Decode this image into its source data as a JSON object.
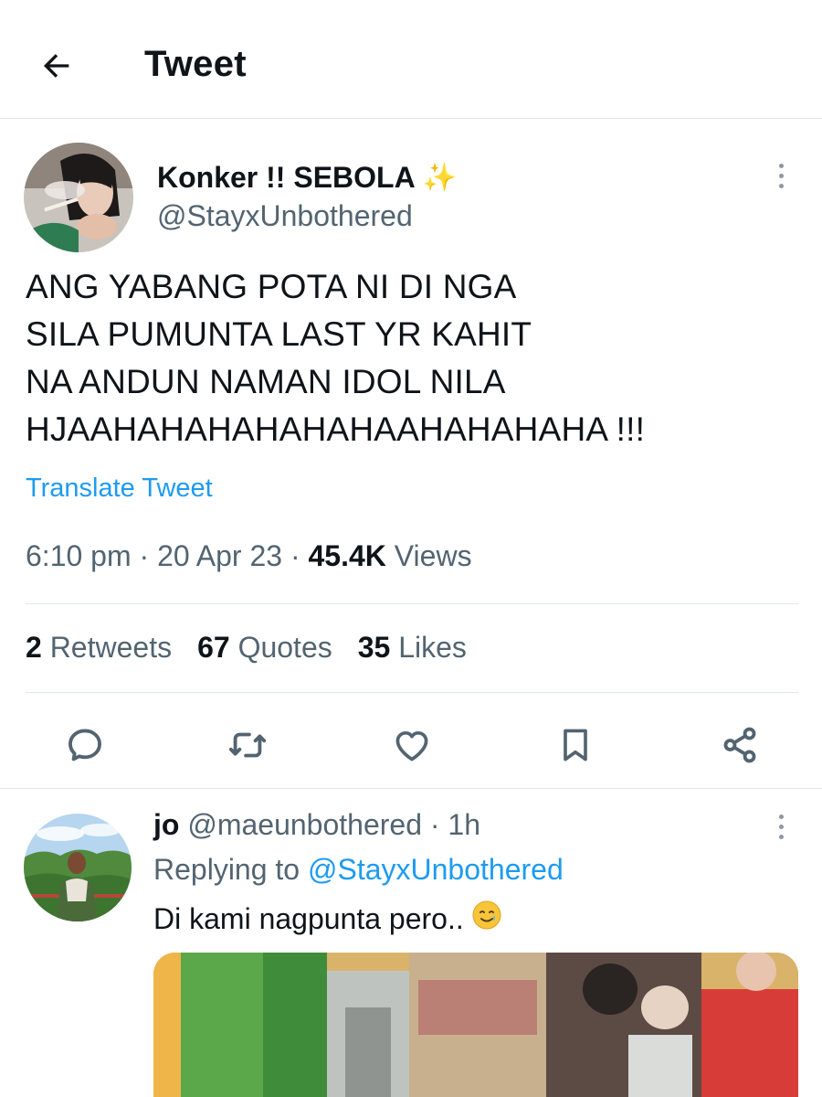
{
  "header": {
    "title": "Tweet"
  },
  "tweet": {
    "display_name": "Konker !! SEBOLA",
    "handle": "@StayxUnbothered",
    "text": "ANG YABANG POTA NI DI NGA\nSILA PUMUNTA LAST YR KAHIT\nNA ANDUN NAMAN IDOL NILA\nHJAAHAHAHAHAHAHAAHAHAHAHA !!!",
    "translate_label": "Translate Tweet",
    "time": "6:10 pm",
    "date": "20 Apr 23",
    "views_count": "45.4K",
    "views_label": "Views",
    "retweets_count": "2",
    "retweets_label": "Retweets",
    "quotes_count": "67",
    "quotes_label": "Quotes",
    "likes_count": "35",
    "likes_label": "Likes"
  },
  "actions": [
    "reply-icon",
    "retweet-icon",
    "like-icon",
    "bookmark-icon",
    "share-icon"
  ],
  "reply": {
    "name": "jo",
    "handle": "@maeunbothered",
    "age": "1h",
    "replying_prefix": "Replying to",
    "replying_to": "@StayxUnbothered",
    "text": "Di kami nagpunta pero.."
  },
  "colors": {
    "accent": "#1d9bf0",
    "secondary_text": "#536471",
    "divider": "#e1e6ea"
  }
}
